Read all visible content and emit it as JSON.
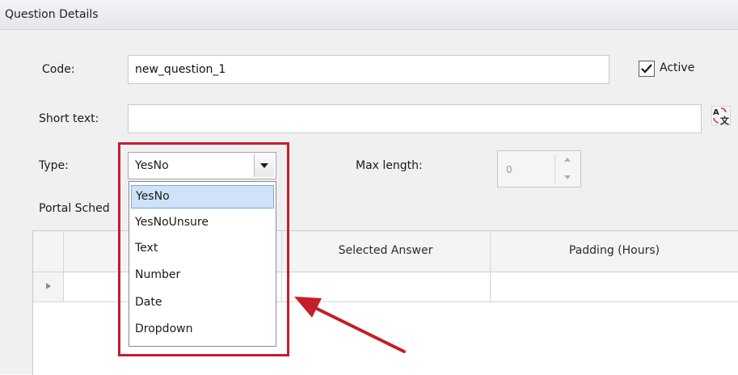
{
  "header": {
    "title": "Question Details"
  },
  "form": {
    "code_label": "Code:",
    "code_value": "new_question_1",
    "active_label": "Active",
    "active_checked": true,
    "short_text_label": "Short text:",
    "short_text_value": "",
    "type_label": "Type:",
    "type_value": "YesNo",
    "max_length_label": "Max length:",
    "max_length_value": "0",
    "portal_label": "Portal Sched"
  },
  "dropdown": {
    "options": [
      "YesNo",
      "YesNoUnsure",
      "Text",
      "Number",
      "Date",
      "Dropdown"
    ],
    "selected_index": 0
  },
  "grid": {
    "columns": [
      "",
      "Selected Answer",
      "Padding (Hours)"
    ]
  },
  "colors": {
    "highlight": "#c41e2a",
    "selection": "#cfe2f8"
  },
  "icons": [
    "checkmark-icon",
    "translate-icon",
    "chevron-down-icon",
    "spin-up-icon",
    "spin-down-icon",
    "row-indicator-icon",
    "annotation-arrow-icon"
  ]
}
